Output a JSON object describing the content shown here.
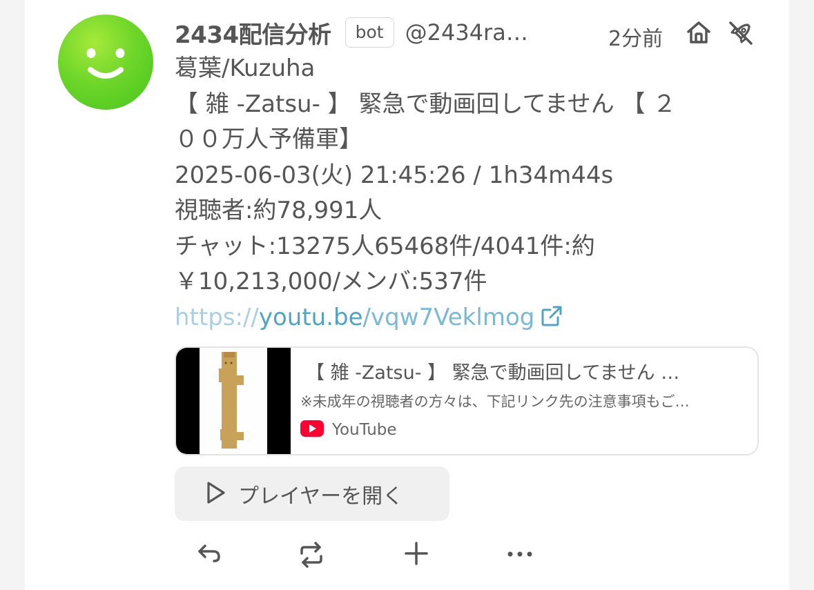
{
  "note": {
    "author_name": "2434配信分析",
    "bot_badge": "bot",
    "handle": "@2434ra…",
    "time_ago": "2分前",
    "lines": [
      "葛葉/Kuzuha",
      "【 雑 -Zatsu- 】 緊急で動画回してません 【 ２",
      "００万人予備軍】",
      "2025-06-03(火) 21:45:26 / 1h34m44s",
      "視聴者:約78,991人",
      "チャット:13275人65468件/4041件:約",
      "￥10,213,000/メンバ:537件"
    ],
    "link": {
      "prefix": "https://",
      "host": "youtu.be",
      "path": "/vqw7Veklmog"
    }
  },
  "preview": {
    "title": "【 雑 -Zatsu- 】 緊急で動画回してません …",
    "description": "※未成年の視聴者の方々は、下記リンク先の注意事項もご…",
    "site": "YouTube",
    "site_color": "#ff0033"
  },
  "player": {
    "label": "プレイヤーを開く"
  },
  "icons": {
    "avatar": "smiley-face",
    "home": "home-icon",
    "no_federation": "rocket-off-icon",
    "external": "external-link-icon",
    "play": "play-icon",
    "reply": "reply-icon",
    "renote": "repeat-icon",
    "react": "plus-icon",
    "more": "more-icon"
  },
  "colors": {
    "avatar": "#6fd62a",
    "text": "#555555",
    "link": "#4fa4c6"
  }
}
